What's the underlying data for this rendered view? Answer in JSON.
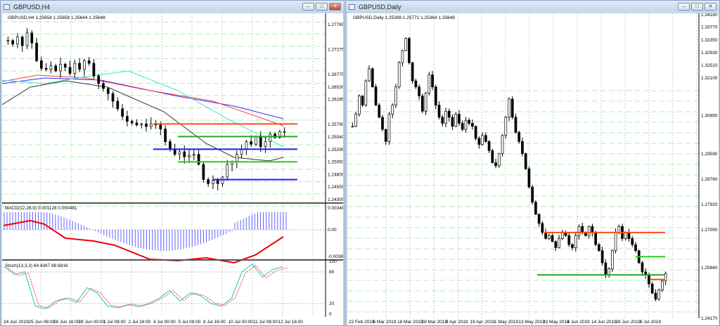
{
  "left": {
    "title": "GBPUSD,H4",
    "header": "GBPUSD,H4  1.25658 1.25658 1.25644 1.25648",
    "price_labels": [
      "1.27765",
      "1.27275",
      "1.26775",
      "1.26530",
      "1.26285",
      "1.25790",
      "1.25540",
      "1.25295",
      "1.25050",
      "1.24800",
      "1.24555",
      "1.24305"
    ],
    "price_values": [
      1.27765,
      1.27275,
      1.26775,
      1.2653,
      1.26285,
      1.2579,
      1.2554,
      1.25295,
      1.2505,
      1.248,
      1.24555,
      1.24305
    ],
    "closes": [
      1.2745,
      1.2738,
      1.2752,
      1.2735,
      1.276,
      1.274,
      1.2705,
      1.269,
      1.2688,
      1.2695,
      1.2685,
      1.2698,
      1.2692,
      1.268,
      1.27,
      1.2688,
      1.2705,
      1.27,
      1.2675,
      1.266,
      1.265,
      1.264,
      1.2625,
      1.261,
      1.2595,
      1.2585,
      1.2582,
      1.2578,
      1.258,
      1.2575,
      1.258,
      1.2578,
      1.257,
      1.2545,
      1.253,
      1.252,
      1.2525,
      1.2515,
      1.2518,
      1.252,
      1.25,
      1.247,
      1.2462,
      1.2468,
      1.2462,
      1.2475,
      1.25,
      1.2505,
      1.252,
      1.253,
      1.2545,
      1.254,
      1.2555,
      1.2535,
      1.2545,
      1.256,
      1.2553,
      1.2565,
      1.2565
    ],
    "levels": [
      {
        "price": 1.258,
        "color": "#ff4a1c"
      },
      {
        "price": 1.2555,
        "color": "#22a822"
      },
      {
        "price": 1.253,
        "color": "#1a1aff"
      },
      {
        "price": 1.2505,
        "color": "#22cc22"
      },
      {
        "price": 1.247,
        "color": "#1a1aff"
      }
    ],
    "macd": {
      "label": "MACD(12,26,9) 0.001128 0.000481",
      "top": "0.003489",
      "zero": "0.00",
      "bottom": "-0.003855"
    },
    "stoch": {
      "label": "Stoch(13,3,3) 84.4367 88.6816",
      "ticks": [
        "100",
        "80",
        "20",
        "0"
      ]
    },
    "time_labels": [
      "24 Jun 2019",
      "25 Jun 08:00",
      "26 Jun 16:00",
      "28 Jun 00:00",
      "1 Jul 08:00",
      "2 Jul 16:00",
      "4 Jul 00:00",
      "5 Jul 08:00",
      "8 Jul 16:00",
      "10 Jul 00:00",
      "11 Jul 08:00",
      "12 Jul 16:00"
    ]
  },
  "right": {
    "title": "GBPUSD,Daily",
    "header": "GBPUSD,Daily  1.25398 1.25771 1.25364 1.25648",
    "price_labels": [
      "1.34180",
      "1.33770",
      "1.33350",
      "1.32930",
      "1.32510",
      "1.32100",
      "1.30850",
      "1.29590",
      "1.28760",
      "1.27920",
      "1.27090",
      "1.25840",
      "1.24170"
    ],
    "price_values": [
      1.3418,
      1.3377,
      1.3335,
      1.3293,
      1.3251,
      1.321,
      1.3085,
      1.2959,
      1.2876,
      1.2792,
      1.2709,
      1.2584,
      1.2417
    ],
    "closes": [
      1.305,
      1.309,
      1.315,
      1.312,
      1.32,
      1.324,
      1.318,
      1.312,
      1.308,
      1.304,
      1.3,
      1.309,
      1.312,
      1.318,
      1.326,
      1.33,
      1.334,
      1.326,
      1.32,
      1.318,
      1.315,
      1.31,
      1.316,
      1.322,
      1.318,
      1.312,
      1.308,
      1.306,
      1.31,
      1.308,
      1.305,
      1.309,
      1.306,
      1.304,
      1.307,
      1.306,
      1.305,
      1.301,
      1.299,
      1.302,
      1.3,
      1.297,
      1.293,
      1.292,
      1.296,
      1.302,
      1.308,
      1.314,
      1.308,
      1.303,
      1.3,
      1.296,
      1.291,
      1.285,
      1.28,
      1.276,
      1.273,
      1.27,
      1.268,
      1.269,
      1.267,
      1.265,
      1.268,
      1.27,
      1.269,
      1.266,
      1.265,
      1.269,
      1.272,
      1.27,
      1.269,
      1.272,
      1.27,
      1.266,
      1.264,
      1.26,
      1.256,
      1.258,
      1.264,
      1.27,
      1.272,
      1.268,
      1.27,
      1.268,
      1.266,
      1.264,
      1.26,
      1.257,
      1.256,
      1.253,
      1.25,
      1.248,
      1.251,
      1.254,
      1.2565
    ],
    "levels": [
      {
        "price": 1.27,
        "color": "#ff4a1c",
        "from": 0.56
      },
      {
        "price": 1.262,
        "color": "#22cc22",
        "from": 0.82
      },
      {
        "price": 1.256,
        "color": "#22a822",
        "from": 0.54
      },
      {
        "price": 1.2545,
        "color": "#ff4a1c",
        "from": 0.86
      }
    ],
    "time_labels": [
      "22 Feb 2019",
      "6 Mar 2019",
      "18 Mar 2019",
      "28 Mar 2019",
      "9 Apr 2019",
      "19 Apr 2019",
      "1 May 2019",
      "13 May 2019",
      "23 May 2019",
      "4 Jun 2019",
      "14 Jun 2019",
      "26 Jun 2019",
      "8 Jul 2019"
    ]
  },
  "window_buttons": {
    "minimize": "–",
    "maximize": "□",
    "close": "✕"
  }
}
